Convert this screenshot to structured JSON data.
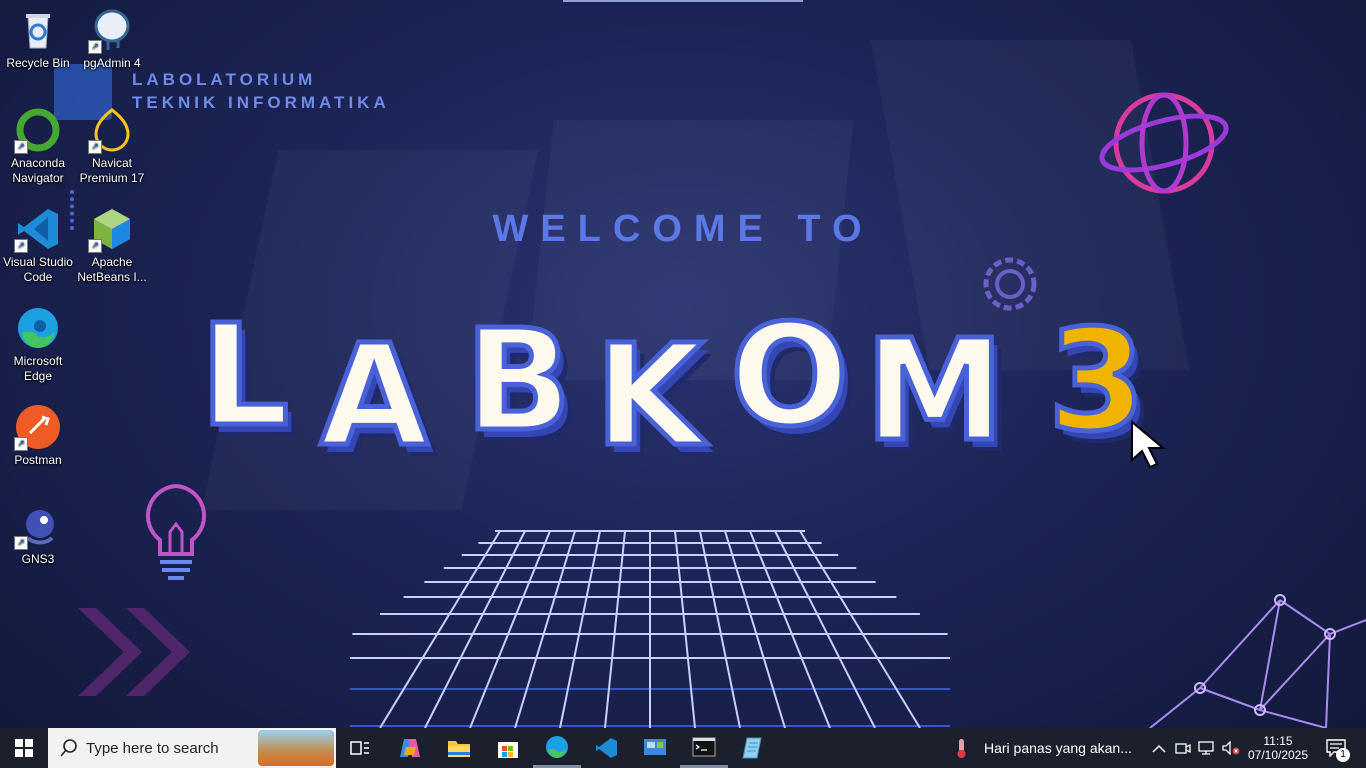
{
  "desktop": {
    "icons": [
      {
        "label": "Recycle Bin",
        "icon": "recycle-bin-icon"
      },
      {
        "label": "pgAdmin 4",
        "icon": "elephant-icon"
      },
      {
        "label": "Anaconda Navigator",
        "icon": "anaconda-ring-icon"
      },
      {
        "label": "Navicat Premium 17",
        "icon": "navicat-icon"
      },
      {
        "label": "Visual Studio Code",
        "icon": "vscode-icon"
      },
      {
        "label": "Apache NetBeans I...",
        "icon": "netbeans-cube-icon"
      },
      {
        "label": "Microsoft Edge",
        "icon": "edge-icon"
      },
      {
        "label": "Postman",
        "icon": "postman-icon"
      },
      {
        "label": "GNS3",
        "icon": "gns3-chameleon-icon"
      }
    ]
  },
  "wallpaper": {
    "lab_line1": "LABOLATORIUM",
    "lab_line2": "TEKNIK INFORMATIKA",
    "welcome": "WELCOME TO",
    "letters": [
      "L",
      "A",
      "B",
      "K",
      "O",
      "M",
      "3"
    ]
  },
  "taskbar": {
    "search_placeholder": "Type here to search",
    "pinned": [
      "task-view-icon",
      "copilot-icon",
      "file-explorer-icon",
      "microsoft-store-icon",
      "edge-icon",
      "vscode-icon",
      "control-panel-icon",
      "terminal-icon",
      "notepad-icon"
    ],
    "weather_text": "Hari panas yang akan...",
    "time": "11:15",
    "date": "07/10/2025",
    "notification_count": "1"
  },
  "colors": {
    "accent": "#5b78e6",
    "three": "#f0b400",
    "taskbar": "#1c1f2c"
  }
}
